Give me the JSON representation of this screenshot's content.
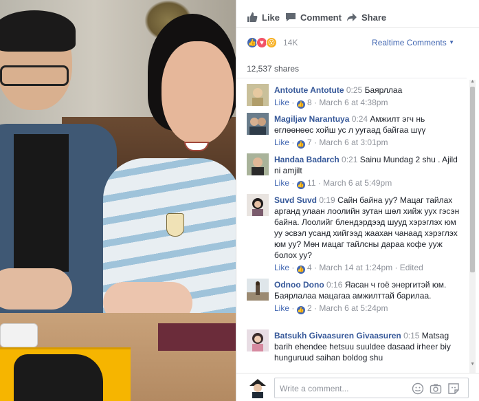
{
  "actions": {
    "like": "Like",
    "comment": "Comment",
    "share": "Share"
  },
  "reactions": {
    "count": "14K",
    "realtime_label": "Realtime Comments",
    "types": [
      "like",
      "love",
      "wow"
    ]
  },
  "shares": "12,537 shares",
  "comments": [
    {
      "name": "Antotute Antotute",
      "time": "0:25",
      "text": "Баярллаа",
      "likes": "8",
      "date": "March 6 at 4:38pm",
      "like_label": "Like",
      "edited": ""
    },
    {
      "name": "Magiljav Narantuya",
      "time": "0:24",
      "text": "Амжилт эгч нь өглөөнөөс хойш ус л уугаад байгаа шүү",
      "likes": "7",
      "date": "March 6 at 3:01pm",
      "like_label": "Like",
      "edited": ""
    },
    {
      "name": "Handaa Badarch",
      "time": "0:21",
      "text": "Sainu Mundag 2 shu . Ajild ni amjilt",
      "likes": "11",
      "date": "March 6 at 5:49pm",
      "like_label": "Like",
      "edited": ""
    },
    {
      "name": "Suvd Suvd",
      "time": "0:19",
      "text": "Сайн байна уу? Мацаг тайлах арганд улаан лоолийн зутан шөл хийж уух гэсэн байна. Лоолийг блендэрдээд шууд хэрэглэх юм уу эсвэл усанд хийгээд жаахан чанаад хэрэглэх юм уу? Мөн мацаг тайлсны дараа кофе ууж болох уу?",
      "likes": "4",
      "date": "March 14 at 1:24pm",
      "like_label": "Like",
      "edited": "Edited"
    },
    {
      "name": "Odnoo Dono",
      "time": "0:16",
      "text": "Яасан ч гоё энергитэй юм. Баярлалаа мацагаа амжилттай барилаа.",
      "likes": "2",
      "date": "March 6 at 5:24pm",
      "like_label": "Like",
      "edited": ""
    },
    {
      "name": "Batsukh Givaasuren Givaasuren",
      "time": "0:15",
      "text": "Matsag barih ehendee hetsuu suuldee dasaad irheer biy hunguruud saihan boldog shu",
      "likes": "",
      "date": "",
      "like_label": "",
      "edited": ""
    }
  ],
  "composer": {
    "placeholder": "Write a comment..."
  },
  "colors": {
    "link": "#365899",
    "accent": "#4267b2",
    "meta": "#90949c",
    "yellow": "#f6b500"
  }
}
